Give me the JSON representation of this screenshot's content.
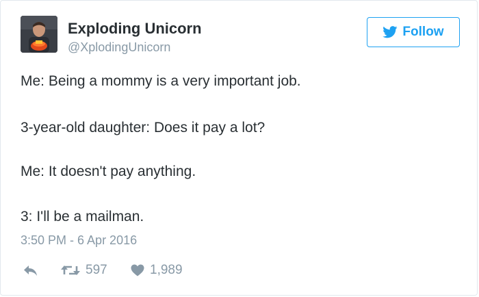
{
  "author": {
    "name": "Exploding Unicorn",
    "handle": "@XplodingUnicorn"
  },
  "follow_button": {
    "label": "Follow",
    "icon": "twitter-bird-icon"
  },
  "tweet": {
    "lines": [
      "Me: Being a mommy is a very important job.",
      "3-year-old daughter: Does it pay a lot?",
      "Me: It doesn't pay anything.",
      "3: I'll be a mailman."
    ],
    "timestamp": "3:50 PM - 6 Apr 2016"
  },
  "actions": {
    "reply": {
      "icon": "reply-icon"
    },
    "retweet": {
      "icon": "retweet-icon",
      "count": "597"
    },
    "like": {
      "icon": "heart-icon",
      "count": "1,989"
    }
  },
  "colors": {
    "accent": "#1da1f2",
    "text": "#292f33",
    "muted": "#8899a6",
    "border": "#e1e8ed"
  }
}
